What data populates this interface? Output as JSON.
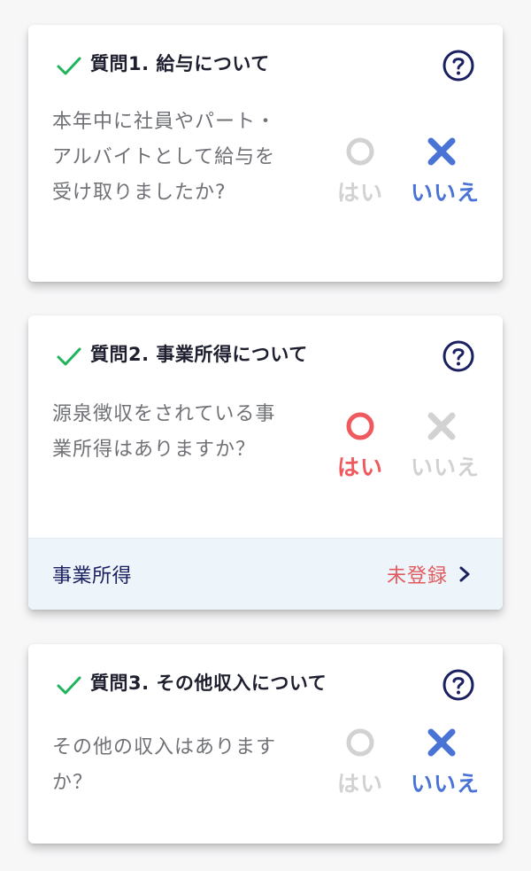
{
  "questions": [
    {
      "title": "質問1. 給与について",
      "text": "本年中に社員やパート・アルバイトとして給与を受け取りましたか?",
      "yes_label": "はい",
      "no_label": "いいえ",
      "selected": "no"
    },
    {
      "title": "質問2. 事業所得について",
      "text": "源泉徴収をされている事業所得はありますか？",
      "yes_label": "はい",
      "no_label": "いいえ",
      "selected": "yes",
      "footer": {
        "label": "事業所得",
        "status": "未登録"
      }
    },
    {
      "title": "質問3. その他収入について",
      "text": "その他の収入はありますか？",
      "yes_label": "はい",
      "no_label": "いいえ",
      "selected": "no"
    }
  ],
  "icons": {
    "completed": "check-icon",
    "help": "question-circle-icon",
    "yes": "circle-icon",
    "no": "x-icon",
    "footer_arrow": "chevron-right-icon"
  },
  "colors": {
    "check": "#1fb35b",
    "help": "#1a2060",
    "yes_selected": "#ef5a5f",
    "no_selected": "#4a73d6",
    "unselected": "#d2d2d2",
    "footer_bg": "#eef5fa",
    "footer_label": "#1a2060",
    "footer_status": "#e25a5e"
  }
}
